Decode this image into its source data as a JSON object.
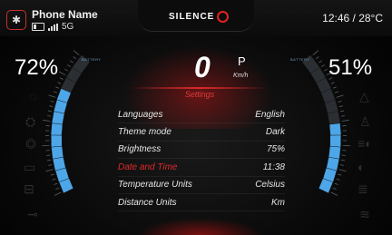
{
  "status_bar": {
    "phone_name": "Phone Name",
    "network": "5G",
    "brand": "SILENCE",
    "time_temp": "12:46 / 28°C"
  },
  "left_battery": {
    "percent_text": "72%",
    "label": "BATTERY",
    "level": 0.72
  },
  "right_battery": {
    "percent_text": "51%",
    "label": "BATTERY",
    "level": 0.51
  },
  "speedometer": {
    "speed": "0",
    "gear": "P",
    "unit": "Km/h"
  },
  "settings": {
    "title": "Settings",
    "items": [
      {
        "label": "Languages",
        "value": "English"
      },
      {
        "label": "Theme mode",
        "value": "Dark"
      },
      {
        "label": "Brightness",
        "value": "75%"
      },
      {
        "label": "Date and Time",
        "value": "11:38"
      },
      {
        "label": "Temperature Units",
        "value": "Celsius"
      },
      {
        "label": "Distance Units",
        "value": "Km"
      }
    ],
    "active_index": 3
  },
  "colors": {
    "accent_red": "#e0231f",
    "gauge_blue": "#4da6e8"
  },
  "icons": {
    "left": [
      "phone-icon",
      "hazard-icon",
      "motor-icon",
      "battery-warning-icon",
      "lock-icon",
      "key-icon"
    ],
    "right": [
      "warning-icon",
      "person-icon",
      "lights-icon",
      "low-beam-icon",
      "high-beam-icon",
      "fog-light-icon"
    ]
  }
}
